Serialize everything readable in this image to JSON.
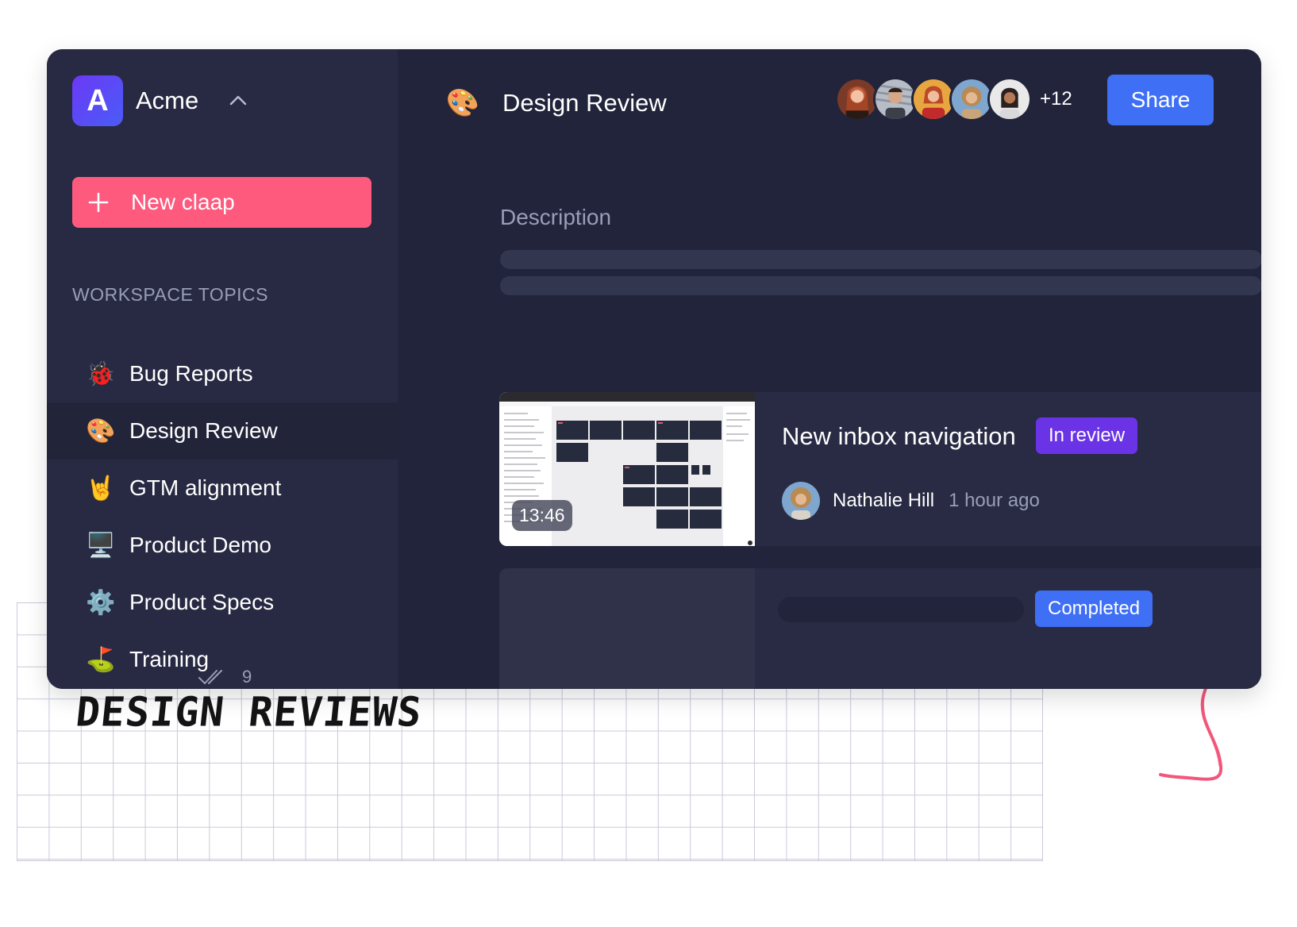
{
  "workspace": {
    "logo_letter": "A",
    "name": "Acme"
  },
  "sidebar": {
    "new_button_label": "New claap",
    "section_title": "WORKSPACE TOPICS",
    "topics": [
      {
        "emoji": "🐞",
        "label": "Bug Reports"
      },
      {
        "emoji": "🎨",
        "label": "Design Review"
      },
      {
        "emoji": "🤘",
        "label": "GTM alignment"
      },
      {
        "emoji": "🖥️",
        "label": "Product Demo"
      },
      {
        "emoji": "⚙️",
        "label": "Product Specs"
      },
      {
        "emoji": "⛳",
        "label": "Training"
      }
    ],
    "active_topic": "Design Review",
    "seen_count": "9"
  },
  "header": {
    "emoji": "🎨",
    "title": "Design Review",
    "extra_members": "+12",
    "share_label": "Share"
  },
  "main": {
    "description_label": "Description",
    "cards": [
      {
        "title": "New inbox navigation",
        "status": "In review",
        "duration": "13:46",
        "author": "Nathalie Hill",
        "time": "1 hour ago"
      },
      {
        "status": "Completed"
      }
    ]
  },
  "overlay": {
    "handwritten_caption": "DESIGN REVIEWS"
  },
  "colors": {
    "primary_blue": "#3f6ff5",
    "new_claap_pink": "#fd5a7e",
    "in_review_purple": "#6b33e6",
    "sidebar_bg": "#272a42",
    "main_bg": "#21243a"
  }
}
